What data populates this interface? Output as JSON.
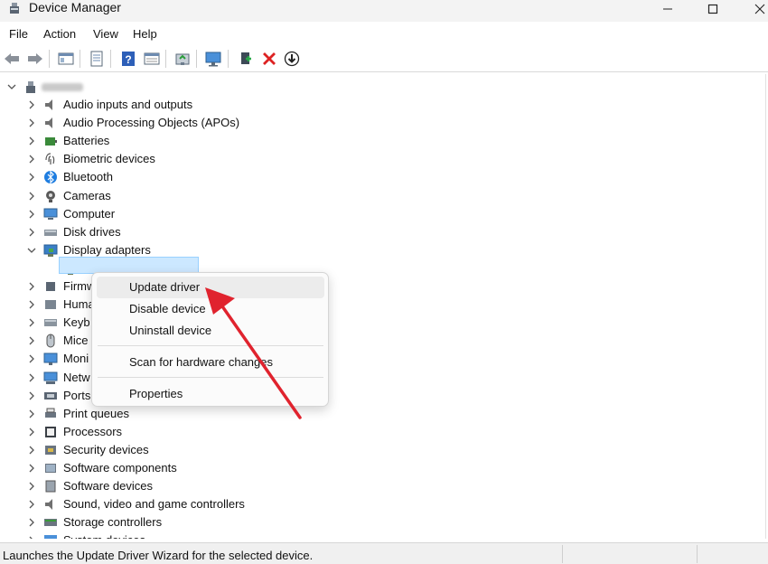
{
  "window": {
    "title": "Device Manager"
  },
  "menu": [
    "File",
    "Action",
    "View",
    "Help"
  ],
  "tree": {
    "root_label": "",
    "categories": [
      {
        "label": "Audio inputs and outputs",
        "icon": "speaker-icon"
      },
      {
        "label": "Audio Processing Objects (APOs)",
        "icon": "speaker-icon"
      },
      {
        "label": "Batteries",
        "icon": "battery-icon"
      },
      {
        "label": "Biometric devices",
        "icon": "fingerprint-icon"
      },
      {
        "label": "Bluetooth",
        "icon": "bluetooth-icon"
      },
      {
        "label": "Cameras",
        "icon": "camera-icon"
      },
      {
        "label": "Computer",
        "icon": "computer-icon"
      },
      {
        "label": "Disk drives",
        "icon": "disk-icon"
      },
      {
        "label": "Display adapters",
        "icon": "display-adapter-icon"
      },
      {
        "label": "",
        "icon": "display-adapter-icon"
      },
      {
        "label": "Firmw",
        "icon": "chip-icon"
      },
      {
        "label": "Huma",
        "icon": "hid-icon"
      },
      {
        "label": "Keyb",
        "icon": "keyboard-icon"
      },
      {
        "label": "Mice",
        "icon": "mouse-icon"
      },
      {
        "label": "Moni",
        "icon": "monitor-icon"
      },
      {
        "label": "Netw",
        "icon": "network-icon"
      },
      {
        "label": "Ports",
        "icon": "port-icon"
      },
      {
        "label": "Print queues",
        "icon": "printer-icon"
      },
      {
        "label": "Processors",
        "icon": "processor-icon"
      },
      {
        "label": "Security devices",
        "icon": "security-icon"
      },
      {
        "label": "Software components",
        "icon": "software-component-icon"
      },
      {
        "label": "Software devices",
        "icon": "software-device-icon"
      },
      {
        "label": "Sound, video and game controllers",
        "icon": "speaker-icon"
      },
      {
        "label": "Storage controllers",
        "icon": "storage-icon"
      },
      {
        "label": "System devices",
        "icon": "system-icon"
      }
    ],
    "selected_device_label": "I"
  },
  "context_menu": {
    "items": [
      "Update driver",
      "Disable device",
      "Uninstall device",
      "Scan for hardware changes",
      "Properties"
    ],
    "highlighted": "Update driver"
  },
  "status": {
    "text": "Launches the Update Driver Wizard for the selected device."
  },
  "colors": {
    "selection": "#cce8ff",
    "annotation_arrow": "#e0232e",
    "bluetooth": "#1e7de0"
  }
}
